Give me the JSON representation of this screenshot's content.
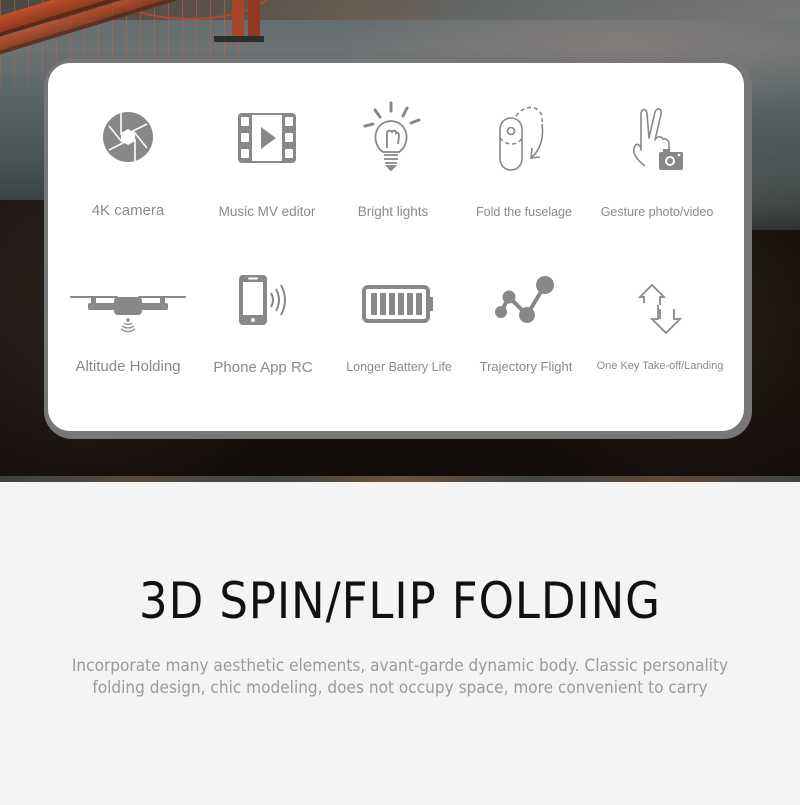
{
  "features": [
    {
      "label": "4K camera",
      "icon": "camera-aperture-icon"
    },
    {
      "label": "Music MV editor",
      "icon": "film-play-icon"
    },
    {
      "label": "Bright lights",
      "icon": "light-bulb-icon"
    },
    {
      "label": "Fold the fuselage",
      "icon": "fold-fuselage-icon"
    },
    {
      "label": "Gesture photo/video",
      "icon": "gesture-camera-icon"
    },
    {
      "label": "Altitude Holding",
      "icon": "drone-altitude-icon"
    },
    {
      "label": "Phone App RC",
      "icon": "phone-signal-icon"
    },
    {
      "label": "Longer Battery Life",
      "icon": "battery-icon"
    },
    {
      "label": "Trajectory Flight",
      "icon": "trajectory-icon"
    },
    {
      "label": "One Key Take-off/Landing",
      "icon": "up-down-arrows-icon"
    }
  ],
  "section": {
    "title": "3D SPIN/FLIP FOLDING",
    "description": "Incorporate many aesthetic elements, avant-garde dynamic body. Classic personality folding design, chic modeling, does not occupy space, more convenient to carry"
  },
  "colors": {
    "icon": "#888888",
    "label": "#8a8a8a",
    "card_border": "#777777",
    "card_bg": "#ffffff",
    "page_bg": "#f4f4f4",
    "title": "#111111",
    "description": "#9a9a9a"
  }
}
